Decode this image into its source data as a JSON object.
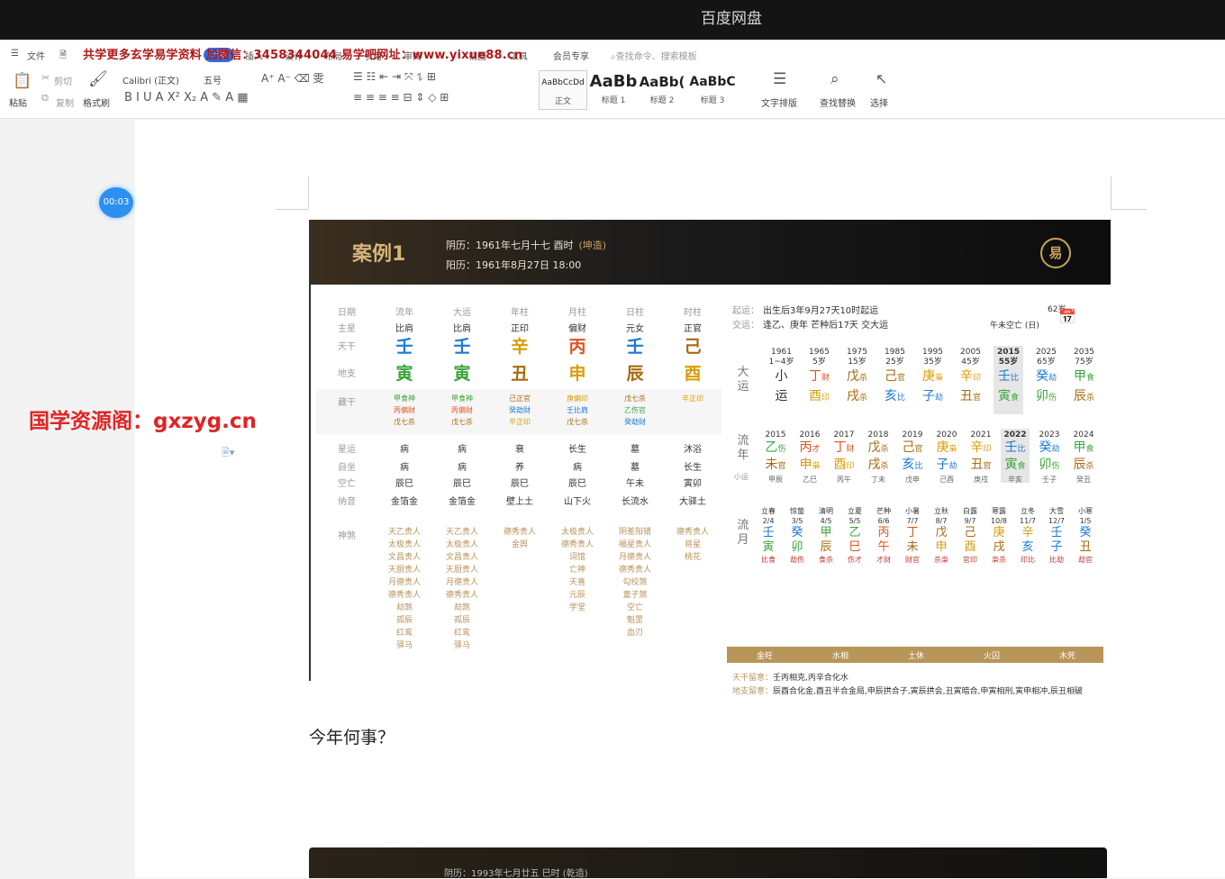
{
  "app_title": "百度网盘",
  "ribbon": {
    "menu_items": [
      "文件",
      "开始",
      "插入",
      "设计",
      "布局",
      "引用",
      "审阅",
      "视图",
      "工具",
      "会员专享",
      "查找命令、搜索模板"
    ],
    "watermark": "共学更多玄学易学资料 加微信：3458344044 易学吧网址：www.yixue88.cn",
    "paste": "粘贴",
    "cut": "剪切",
    "copy": "复制",
    "format_painter": "格式刷",
    "font_name": "Calibri (正文)",
    "font_size": "五号",
    "styles": [
      {
        "preview": "AaBbCcDd",
        "label": "正文"
      },
      {
        "preview": "AaBb",
        "label": "标题 1"
      },
      {
        "preview": "AaBb(",
        "label": "标题 2"
      },
      {
        "preview": "AaBbC",
        "label": "标题 3"
      }
    ],
    "text_layout": "文字排版",
    "find_replace": "查找替换",
    "select": "选择"
  },
  "timer": "00:03",
  "side_watermark": "国学资源阁：gxzyg.cn",
  "case": {
    "title": "案例1",
    "lunar": "阴历：1961年七月十七 酉时",
    "lunar_tag": "(坤造)",
    "solar": "阳历：1961年8月27日 18:00",
    "logo": "易",
    "row_labels": [
      "日期",
      "主星",
      "天干",
      "地支",
      "藏干",
      "星运",
      "自坐",
      "空亡",
      "纳音",
      "神煞"
    ],
    "columns": [
      {
        "date": "流年",
        "star": "比肩",
        "stem": "壬",
        "stem_el": "water",
        "branch": "寅",
        "branch_el": "wood",
        "hidden": [
          [
            "甲食神",
            "wood"
          ],
          [
            "丙偏财",
            "fire"
          ],
          [
            "戊七杀",
            "earth"
          ]
        ],
        "xingyun": "病",
        "zizuo": "病",
        "kongwang": "辰巳",
        "nayin": "金箔金",
        "shensha": [
          "天乙贵人",
          "太极贵人",
          "文昌贵人",
          "天厨贵人",
          "月德贵人",
          "德秀贵人",
          "劫煞",
          "孤辰",
          "红鸾",
          "驿马"
        ]
      },
      {
        "date": "大运",
        "star": "比肩",
        "stem": "壬",
        "stem_el": "water",
        "branch": "寅",
        "branch_el": "wood",
        "hidden": [
          [
            "甲食神",
            "wood"
          ],
          [
            "丙偏财",
            "fire"
          ],
          [
            "戊七杀",
            "earth"
          ]
        ],
        "xingyun": "病",
        "zizuo": "病",
        "kongwang": "辰巳",
        "nayin": "金箔金",
        "shensha": [
          "天乙贵人",
          "太极贵人",
          "文昌贵人",
          "天厨贵人",
          "月德贵人",
          "德秀贵人",
          "劫煞",
          "孤辰",
          "红鸾",
          "驿马"
        ]
      },
      {
        "date": "年柱",
        "star": "正印",
        "stem": "辛",
        "stem_el": "metal",
        "branch": "丑",
        "branch_el": "earth",
        "hidden": [
          [
            "己正官",
            "earth"
          ],
          [
            "癸劫财",
            "water"
          ],
          [
            "辛正印",
            "metal"
          ]
        ],
        "xingyun": "衰",
        "zizuo": "养",
        "kongwang": "辰巳",
        "nayin": "壁上土",
        "shensha": [
          "德秀贵人",
          "金舆"
        ]
      },
      {
        "date": "月柱",
        "star": "偏财",
        "stem": "丙",
        "stem_el": "fire",
        "branch": "申",
        "branch_el": "metal",
        "hidden": [
          [
            "庚偏印",
            "metal"
          ],
          [
            "壬比肩",
            "water"
          ],
          [
            "戊七杀",
            "earth"
          ]
        ],
        "xingyun": "长生",
        "zizuo": "病",
        "kongwang": "辰巳",
        "nayin": "山下火",
        "shensha": [
          "太极贵人",
          "德秀贵人",
          "词馆",
          "亡神",
          "天喜",
          "元辰",
          "学堂"
        ]
      },
      {
        "date": "日柱",
        "star": "元女",
        "stem": "壬",
        "stem_el": "water",
        "branch": "辰",
        "branch_el": "earth",
        "hidden": [
          [
            "戊七杀",
            "earth"
          ],
          [
            "乙伤官",
            "wood"
          ],
          [
            "癸劫财",
            "water"
          ]
        ],
        "xingyun": "墓",
        "zizuo": "墓",
        "kongwang": "午未",
        "nayin": "长流水",
        "shensha": [
          "阴差阳错",
          "福星贵人",
          "月德贵人",
          "德秀贵人",
          "勾绞煞",
          "童子煞",
          "空亡",
          "魁罡",
          "血刃"
        ]
      },
      {
        "date": "时柱",
        "star": "正官",
        "stem": "己",
        "stem_el": "earth",
        "branch": "酉",
        "branch_el": "metal",
        "hidden": [
          [
            "辛正印",
            "metal"
          ]
        ],
        "xingyun": "沐浴",
        "zizuo": "长生",
        "kongwang": "寅卯",
        "nayin": "大驿土",
        "shensha": [
          "德秀贵人",
          "将星",
          "桃花"
        ]
      }
    ],
    "qiyun_label": "起运：",
    "qiyun": "出生后3年9月27天10时起运",
    "jiaoyun_label": "交运：",
    "jiaoyun": "逢乙、庚年 芒种后17天 交大运",
    "age": "62岁",
    "kongwang_note": "午未空亡 (日)",
    "dayun_label": "大运",
    "dayun": [
      {
        "year": "1961",
        "age": "1~4岁",
        "g": "小",
        "z": "运",
        "gs": "",
        "zs": "",
        "ge": "",
        "ze": ""
      },
      {
        "year": "1965",
        "age": "5岁",
        "g": "丁",
        "gs": "财",
        "z": "酉",
        "zs": "印",
        "ge": "fire",
        "ze": "metal"
      },
      {
        "year": "1975",
        "age": "15岁",
        "g": "戊",
        "gs": "杀",
        "z": "戌",
        "zs": "杀",
        "ge": "earth",
        "ze": "earth"
      },
      {
        "year": "1985",
        "age": "25岁",
        "g": "己",
        "gs": "官",
        "z": "亥",
        "zs": "比",
        "ge": "earth",
        "ze": "water"
      },
      {
        "year": "1995",
        "age": "35岁",
        "g": "庚",
        "gs": "枭",
        "z": "子",
        "zs": "劫",
        "ge": "metal",
        "ze": "water"
      },
      {
        "year": "2005",
        "age": "45岁",
        "g": "辛",
        "gs": "印",
        "z": "丑",
        "zs": "官",
        "ge": "metal",
        "ze": "earth"
      },
      {
        "year": "2015",
        "age": "55岁",
        "g": "壬",
        "gs": "比",
        "z": "寅",
        "zs": "食",
        "ge": "water",
        "ze": "wood",
        "selected": true
      },
      {
        "year": "2025",
        "age": "65岁",
        "g": "癸",
        "gs": "劫",
        "z": "卯",
        "zs": "伤",
        "ge": "water",
        "ze": "wood"
      },
      {
        "year": "2035",
        "age": "75岁",
        "g": "甲",
        "gs": "食",
        "z": "辰",
        "zs": "杀",
        "ge": "wood",
        "ze": "earth"
      }
    ],
    "liunian_label": "流年",
    "xiaoyun_label": "小运",
    "liunian": [
      {
        "year": "2015",
        "g": "乙",
        "gs": "伤",
        "z": "未",
        "zs": "官",
        "xy": "甲辰",
        "ge": "wood",
        "ze": "earth"
      },
      {
        "year": "2016",
        "g": "丙",
        "gs": "才",
        "z": "申",
        "zs": "枭",
        "xy": "乙巳",
        "ge": "fire",
        "ze": "metal"
      },
      {
        "year": "2017",
        "g": "丁",
        "gs": "财",
        "z": "酉",
        "zs": "印",
        "xy": "丙午",
        "ge": "fire",
        "ze": "metal"
      },
      {
        "year": "2018",
        "g": "戊",
        "gs": "杀",
        "z": "戌",
        "zs": "杀",
        "xy": "丁未",
        "ge": "earth",
        "ze": "earth"
      },
      {
        "year": "2019",
        "g": "己",
        "gs": "官",
        "z": "亥",
        "zs": "比",
        "xy": "戊申",
        "ge": "earth",
        "ze": "water"
      },
      {
        "year": "2020",
        "g": "庚",
        "gs": "枭",
        "z": "子",
        "zs": "劫",
        "xy": "己酉",
        "ge": "metal",
        "ze": "water"
      },
      {
        "year": "2021",
        "g": "辛",
        "gs": "印",
        "z": "丑",
        "zs": "官",
        "xy": "庚戌",
        "ge": "metal",
        "ze": "earth"
      },
      {
        "year": "2022",
        "g": "壬",
        "gs": "比",
        "z": "寅",
        "zs": "食",
        "xy": "辛亥",
        "ge": "water",
        "ze": "wood",
        "selected": true
      },
      {
        "year": "2023",
        "g": "癸",
        "gs": "劫",
        "z": "卯",
        "zs": "伤",
        "xy": "壬子",
        "ge": "water",
        "ze": "wood"
      },
      {
        "year": "2024",
        "g": "甲",
        "gs": "食",
        "z": "辰",
        "zs": "杀",
        "xy": "癸丑",
        "ge": "wood",
        "ze": "earth"
      }
    ],
    "liuyue_label": "流月",
    "liuyue": [
      {
        "term": "立春",
        "date": "2/4",
        "g": "壬",
        "z": "寅",
        "s": "比食",
        "ge": "water",
        "ze": "wood"
      },
      {
        "term": "惊蛰",
        "date": "3/5",
        "g": "癸",
        "z": "卯",
        "s": "劫伤",
        "ge": "water",
        "ze": "wood"
      },
      {
        "term": "清明",
        "date": "4/5",
        "g": "甲",
        "z": "辰",
        "s": "食杀",
        "ge": "wood",
        "ze": "earth"
      },
      {
        "term": "立夏",
        "date": "5/5",
        "g": "乙",
        "z": "巳",
        "s": "伤才",
        "ge": "wood",
        "ze": "fire"
      },
      {
        "term": "芒种",
        "date": "6/6",
        "g": "丙",
        "z": "午",
        "s": "才财",
        "ge": "fire",
        "ze": "fire"
      },
      {
        "term": "小暑",
        "date": "7/7",
        "g": "丁",
        "z": "未",
        "s": "财官",
        "ge": "fire",
        "ze": "earth"
      },
      {
        "term": "立秋",
        "date": "8/7",
        "g": "戊",
        "z": "申",
        "s": "杀枭",
        "ge": "earth",
        "ze": "metal"
      },
      {
        "term": "白露",
        "date": "9/7",
        "g": "己",
        "z": "酉",
        "s": "官印",
        "ge": "earth",
        "ze": "metal"
      },
      {
        "term": "寒露",
        "date": "10/8",
        "g": "庚",
        "z": "戌",
        "s": "枭杀",
        "ge": "metal",
        "ze": "earth"
      },
      {
        "term": "立冬",
        "date": "11/7",
        "g": "辛",
        "z": "亥",
        "s": "印比",
        "ge": "metal",
        "ze": "water"
      },
      {
        "term": "大雪",
        "date": "12/7",
        "g": "壬",
        "z": "子",
        "s": "比劫",
        "ge": "water",
        "ze": "water"
      },
      {
        "term": "小寒",
        "date": "1/5",
        "g": "癸",
        "z": "丑",
        "s": "劫官",
        "ge": "water",
        "ze": "earth"
      }
    ],
    "wuxing": [
      "金旺",
      "水相",
      "土休",
      "火囚",
      "木死"
    ],
    "tiangan_note_label": "天干留意：",
    "tiangan_note": "壬丙相克,丙辛合化水",
    "dizhi_note_label": "地支留意：",
    "dizhi_note": "辰酉合化金,酉丑半合金局,申辰拱合子,寅辰拱会,丑寅暗合,申寅相刑,寅申相冲,辰丑相破"
  },
  "question": "今年何事？",
  "next_case_lunar": "阴历：1993年七月廿五 巳时 (乾造)",
  "colors": {
    "wood": "#3aa53a",
    "fire": "#e0531f",
    "earth": "#a76a10",
    "metal": "#d99c0a",
    "water": "#1a79d8",
    "gold": "#b89558"
  }
}
